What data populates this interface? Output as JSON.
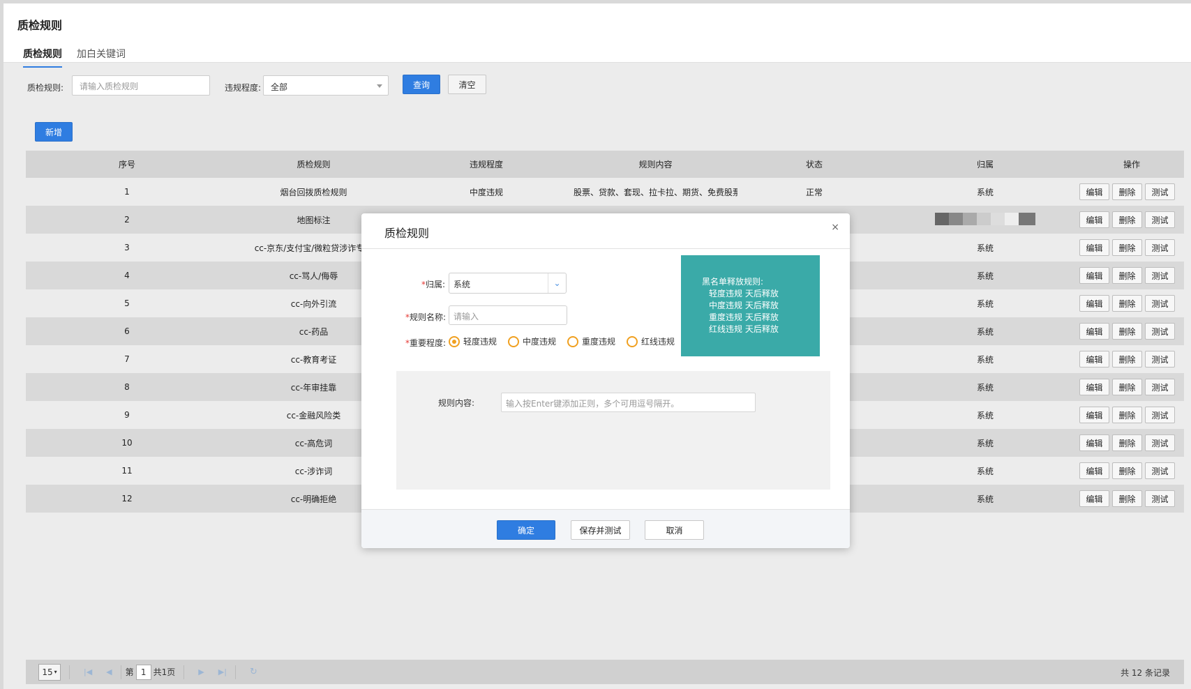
{
  "header": {
    "title": "质检规则",
    "tabs": [
      {
        "label": "质检规则",
        "active": true
      },
      {
        "label": "加白关键词",
        "active": false
      }
    ]
  },
  "filters": {
    "rule_label": "质检规则:",
    "rule_placeholder": "请输入质检规则",
    "level_label": "违规程度:",
    "level_value": "全部",
    "query_label": "查询",
    "clear_label": "清空",
    "add_label": "新增"
  },
  "table": {
    "columns": [
      "序号",
      "质检规则",
      "违规程度",
      "规则内容",
      "状态",
      "归属",
      "操作"
    ],
    "rows": [
      {
        "no": "1",
        "rule": "烟台回拨质检规则",
        "level": "中度违规",
        "content": "股票、贷款、套现、拉卡拉、期货、免费股票、",
        "status": "正常",
        "owner": "系统"
      },
      {
        "no": "2",
        "rule": "地图标注",
        "level": "",
        "content": "",
        "status": "",
        "owner": ""
      },
      {
        "no": "3",
        "rule": "cc-京东/支付宝/微粒贷涉诈专用",
        "level": "",
        "content": "",
        "status": "",
        "owner": "系统"
      },
      {
        "no": "4",
        "rule": "cc-骂人/侮辱",
        "level": "",
        "content": "",
        "status": "",
        "owner": "系统"
      },
      {
        "no": "5",
        "rule": "cc-向外引流",
        "level": "",
        "content": "",
        "status": "",
        "owner": "系统"
      },
      {
        "no": "6",
        "rule": "cc-药品",
        "level": "",
        "content": "",
        "status": "",
        "owner": "系统"
      },
      {
        "no": "7",
        "rule": "cc-教育考证",
        "level": "",
        "content": "",
        "status": "",
        "owner": "系统"
      },
      {
        "no": "8",
        "rule": "cc-年审挂靠",
        "level": "",
        "content": "",
        "status": "",
        "owner": "系统"
      },
      {
        "no": "9",
        "rule": "cc-金融风险类",
        "level": "",
        "content": "",
        "status": "",
        "owner": "系统"
      },
      {
        "no": "10",
        "rule": "cc-高危词",
        "level": "",
        "content": "",
        "status": "",
        "owner": "系统"
      },
      {
        "no": "11",
        "rule": "cc-涉诈词",
        "level": "",
        "content": "",
        "status": "",
        "owner": "系统"
      },
      {
        "no": "12",
        "rule": "cc-明确拒绝",
        "level": "",
        "content": "",
        "status": "",
        "owner": "系统"
      }
    ],
    "ops": {
      "edit": "编辑",
      "delete": "删除",
      "test": "测试"
    }
  },
  "pager": {
    "page_size": "15",
    "page_prefix": "第",
    "page_current": "1",
    "page_suffix": "共1页",
    "total": "共 12 条记录"
  },
  "modal": {
    "title": "质检规则",
    "close": "×",
    "owner_label": "归属:",
    "owner_value": "系统",
    "name_label": "规则名称:",
    "name_placeholder": "请输入",
    "level_label": "重要程度:",
    "levels": [
      {
        "label": "轻度违规",
        "checked": true
      },
      {
        "label": "中度违规",
        "checked": false
      },
      {
        "label": "重度违规",
        "checked": false
      },
      {
        "label": "红线违规",
        "checked": false
      }
    ],
    "tip": {
      "title": "黑名单释放规则:",
      "lines": [
        "轻度违规 天后释放",
        "中度违规 天后释放",
        "重度违规 天后释放",
        "红线违规 天后释放"
      ]
    },
    "content_label": "规则内容:",
    "content_placeholder": "输入按Enter键添加正则，多个可用逗号隔开。",
    "confirm_label": "确定",
    "save_test_label": "保存并测试",
    "cancel_label": "取消"
  },
  "colors": {
    "primary": "#2f7de1",
    "radio": "#f0a020",
    "tip_bg": "#3aaaa8"
  }
}
